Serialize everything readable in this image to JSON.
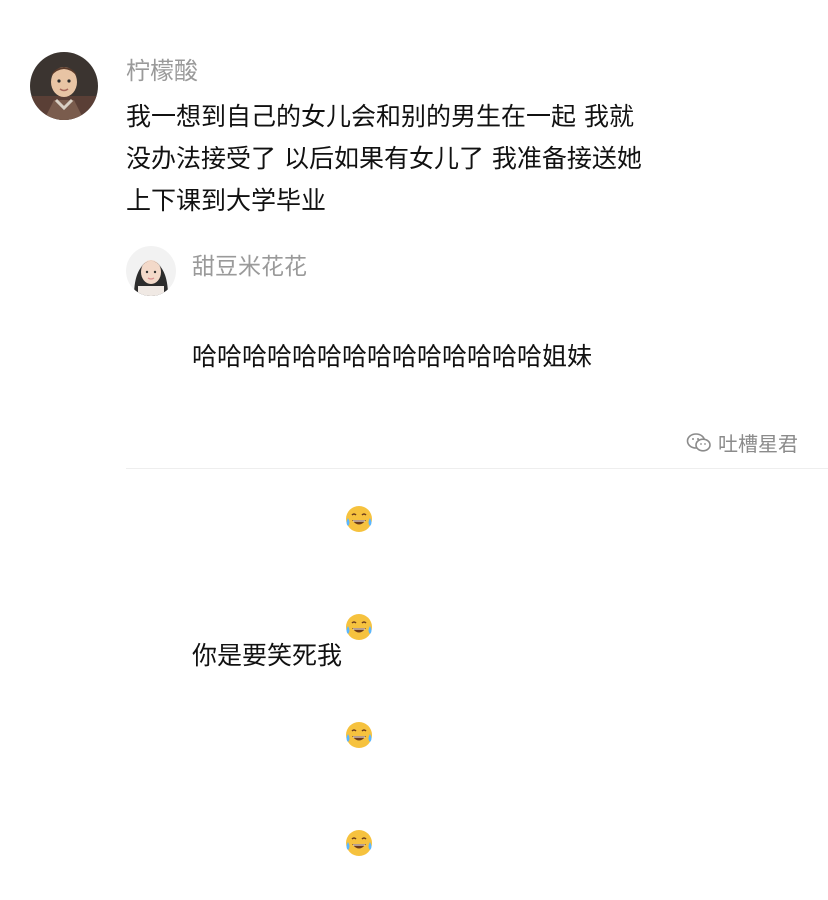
{
  "comment": {
    "username": "柠檬酸",
    "text": "我一想到自己的女儿会和别的男生在一起 我就\n没办法接受了 以后如果有女儿了 我准备接送她\n上下课到大学毕业",
    "avatar_icon": "avatar-boy-icon"
  },
  "reply": {
    "username": "甜豆米花花",
    "text_line1": "哈哈哈哈哈哈哈哈哈哈哈哈哈哈姐妹",
    "text_line2": "你是要笑死我",
    "avatar_icon": "avatar-girl-icon",
    "emoji_icon": "laughing-tears-emoji-icon",
    "emoji_count": 4
  },
  "watermark": {
    "text": "吐槽星君",
    "icon": "wechat-icon"
  },
  "colors": {
    "username": "#9a9a9a",
    "text": "#111111",
    "emoji_face": "#f6c23e"
  }
}
